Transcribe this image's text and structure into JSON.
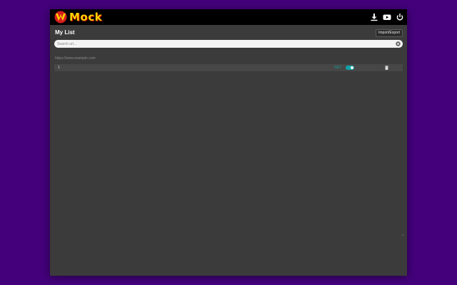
{
  "app": {
    "logo_text": "Mock",
    "colors": {
      "background": "#43007a",
      "panel": "#3b3b3b",
      "accent": "#0fa3a8",
      "logo": "#ffd400"
    }
  },
  "header": {
    "icons": [
      "download-icon",
      "youtube-icon",
      "power-icon"
    ]
  },
  "list": {
    "title": "My List",
    "import_export_label": "Import/Export"
  },
  "search": {
    "placeholder": "Search url...",
    "value": ""
  },
  "groups": [
    {
      "label": "https://www.example.com",
      "rows": [
        {
          "id": "1",
          "method": "GET",
          "enabled": true
        }
      ]
    }
  ],
  "footer": {
    "scroll_top_label": "^"
  }
}
